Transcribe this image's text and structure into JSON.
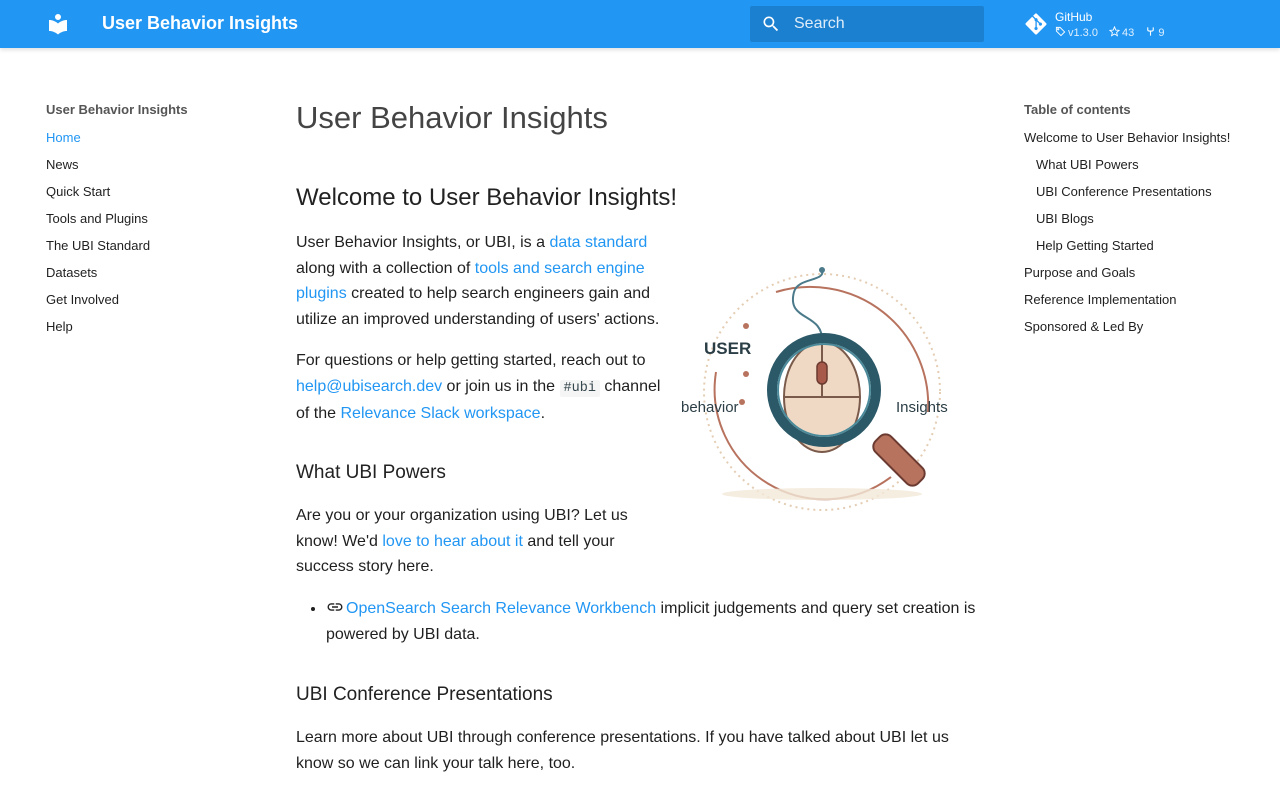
{
  "header": {
    "site_title": "User Behavior Insights",
    "search_placeholder": "Search",
    "repo": {
      "name": "GitHub",
      "version": "v1.3.0",
      "stars": "43",
      "forks": "9"
    },
    "colors": {
      "primary": "#2196f3"
    }
  },
  "nav": {
    "title": "User Behavior Insights",
    "items": [
      {
        "label": "Home",
        "active": true
      },
      {
        "label": "News"
      },
      {
        "label": "Quick Start"
      },
      {
        "label": "Tools and Plugins"
      },
      {
        "label": "The UBI Standard"
      },
      {
        "label": "Datasets"
      },
      {
        "label": "Get Involved"
      },
      {
        "label": "Help"
      }
    ]
  },
  "toc": {
    "title": "Table of contents",
    "items": [
      {
        "label": "Welcome to User Behavior Insights!"
      },
      {
        "label": "What UBI Powers"
      },
      {
        "label": "UBI Conference Presentations"
      },
      {
        "label": "UBI Blogs"
      },
      {
        "label": "Help Getting Started"
      },
      {
        "label": "Purpose and Goals"
      },
      {
        "label": "Reference Implementation"
      },
      {
        "label": "Sponsored & Led By"
      }
    ]
  },
  "content": {
    "page_title": "User Behavior Insights",
    "welcome_heading": "Welcome to User Behavior Insights!",
    "intro": {
      "t1": "User Behavior Insights, or UBI, is a ",
      "link1": "data standard",
      "t2": " along with a collection of ",
      "link2": "tools and search engine plugins",
      "t3": " created to help search engineers gain and utilize an improved understanding of users' actions."
    },
    "questions": {
      "t1": "For questions or help getting started, reach out to ",
      "email": "help@ubisearch.dev",
      "t2": " or join us in the ",
      "channel": "#ubi",
      "t3": " channel of the ",
      "slack": "Relevance Slack workspace",
      "t4": "."
    },
    "powers_heading": "What UBI Powers",
    "powers": {
      "t1": "Are you or your organization using UBI? Let us know! We'd ",
      "link": "love to hear about it",
      "t2": " and tell your success story here."
    },
    "powers_item": {
      "link": "OpenSearch Search Relevance Workbench",
      "text": " implicit judgements and query set creation is powered by UBI data."
    },
    "conf_heading": "UBI Conference Presentations",
    "conf_text": "Learn more about UBI through conference presentations. If you have talked about UBI let us know so we can link your talk here, too.",
    "image": {
      "word_user": "USER",
      "word_behavior": "behavior",
      "word_insights": "Insights"
    }
  }
}
